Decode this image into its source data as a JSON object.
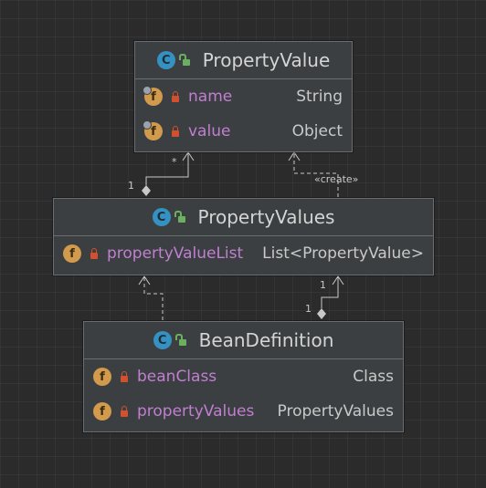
{
  "classes": [
    {
      "name": "PropertyValue",
      "fields": [
        {
          "name": "name",
          "type": "String",
          "final": true
        },
        {
          "name": "value",
          "type": "Object",
          "final": true
        }
      ]
    },
    {
      "name": "PropertyValues",
      "fields": [
        {
          "name": "propertyValueList",
          "type": "List<PropertyValue>",
          "final": true
        }
      ]
    },
    {
      "name": "BeanDefinition",
      "fields": [
        {
          "name": "beanClass",
          "type": "Class",
          "final": false
        },
        {
          "name": "propertyValues",
          "type": "PropertyValues",
          "final": false
        }
      ]
    }
  ],
  "edges": [
    {
      "kind": "aggregation",
      "from": "PropertyValues",
      "to": "PropertyValue",
      "source_label": "1",
      "target_label": "*"
    },
    {
      "kind": "dependency",
      "from": "PropertyValues",
      "to": "PropertyValue",
      "label": "«create»"
    },
    {
      "kind": "aggregation",
      "from": "BeanDefinition",
      "to": "PropertyValues",
      "source_label": "1",
      "target_label": "1"
    },
    {
      "kind": "dependency",
      "from": "BeanDefinition",
      "to": "PropertyValues"
    }
  ],
  "icons": {
    "class_letter": "C",
    "field_letter": "f"
  }
}
